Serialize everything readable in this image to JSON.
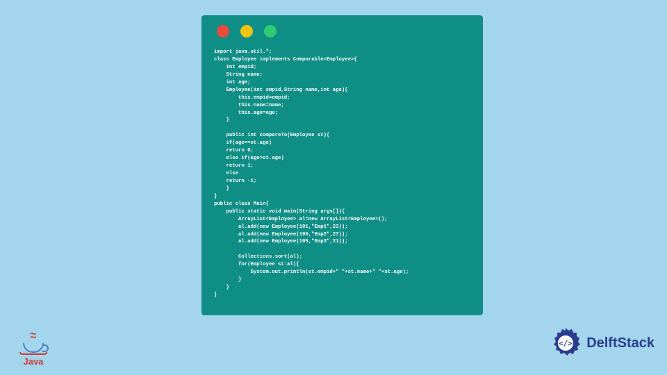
{
  "code_lines": [
    "import java.util.*;",
    "class Employee implements Comparable<Employee>{",
    "    int empid;",
    "    String name;",
    "    int age;",
    "    Employee(int empid,String name,int age){",
    "        this.empid=empid;",
    "        this.name=name;",
    "        this.age=age;",
    "    }",
    "",
    "    public int compareTo(Employee st){",
    "    if(age==st.age)",
    "    return 0;",
    "    else if(age>st.age)",
    "    return 1;",
    "    else",
    "    return -1;",
    "    }",
    "}",
    "public class Main{",
    "    public static void main(String args[]){",
    "        ArrayList<Employee> al=new ArrayList<Employee>();",
    "        al.add(new Employee(101,\"Emp1\",23));",
    "        al.add(new Employee(106,\"Emp2\",27));",
    "        al.add(new Employee(105,\"Emp3\",21));",
    "",
    "        Collections.sort(al);",
    "        for(Employee st:al){",
    "            System.out.println(st.empid+\" \"+st.name+\" \"+st.age);",
    "        }",
    "    }",
    "}"
  ],
  "java_logo_text": "Java",
  "delft_logo_text": "DelftStack"
}
